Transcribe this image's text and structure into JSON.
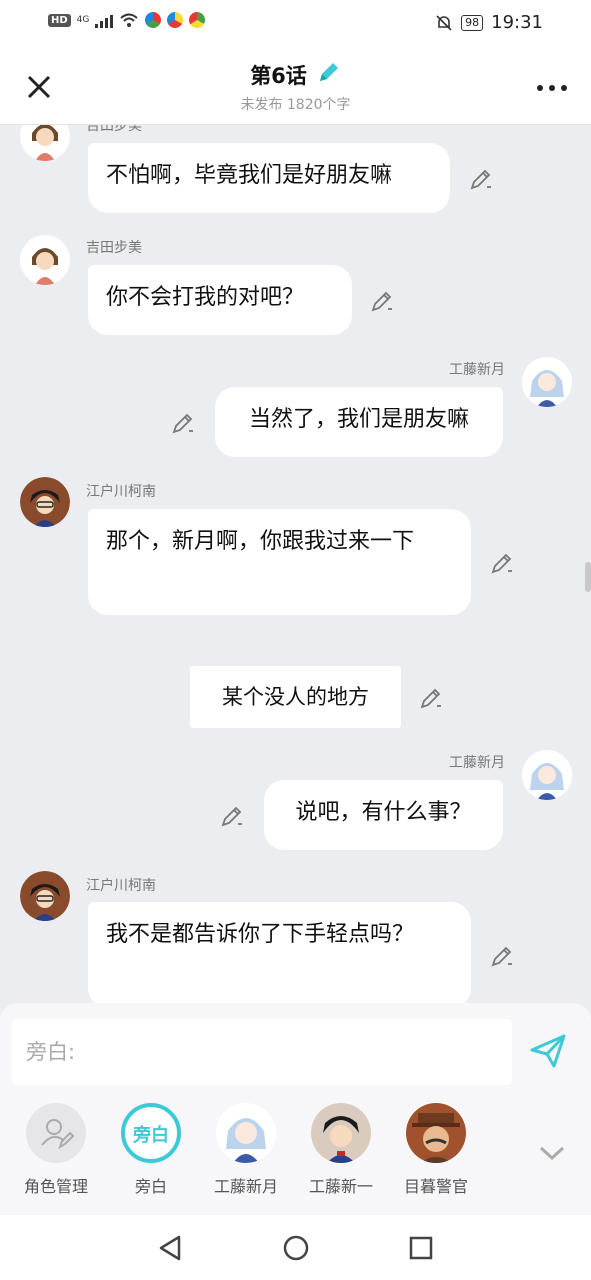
{
  "status_bar": {
    "hd": "HD",
    "network": "4G",
    "battery": "98",
    "time": "19:31"
  },
  "header": {
    "title": "第6话",
    "subtitle": "未发布 1820个字"
  },
  "messages": [
    {
      "speaker": "吉田步美",
      "text": "不怕啊，毕竟我们是好朋友嘛"
    },
    {
      "speaker": "吉田步美",
      "text": "你不会打我的对吧？"
    },
    {
      "speaker": "工藤新月",
      "text": "当然了，我们是朋友嘛"
    },
    {
      "speaker": "江户川柯南",
      "text": "那个，新月啊，你跟我过来一下"
    },
    {
      "speaker": "",
      "text": "某个没人的地方"
    },
    {
      "speaker": "工藤新月",
      "text": "说吧，有什么事？"
    },
    {
      "speaker": "江户川柯南",
      "text": "我不是都告诉你了下手轻点吗？"
    }
  ],
  "composer": {
    "placeholder": "旁白:"
  },
  "roles": [
    {
      "label": "角色管理"
    },
    {
      "label": "旁白",
      "badge": "旁白"
    },
    {
      "label": "工藤新月"
    },
    {
      "label": "工藤新一"
    },
    {
      "label": "目暮警官"
    }
  ],
  "colors": {
    "accent": "#3ec9d6",
    "background": "#ecedf1"
  }
}
